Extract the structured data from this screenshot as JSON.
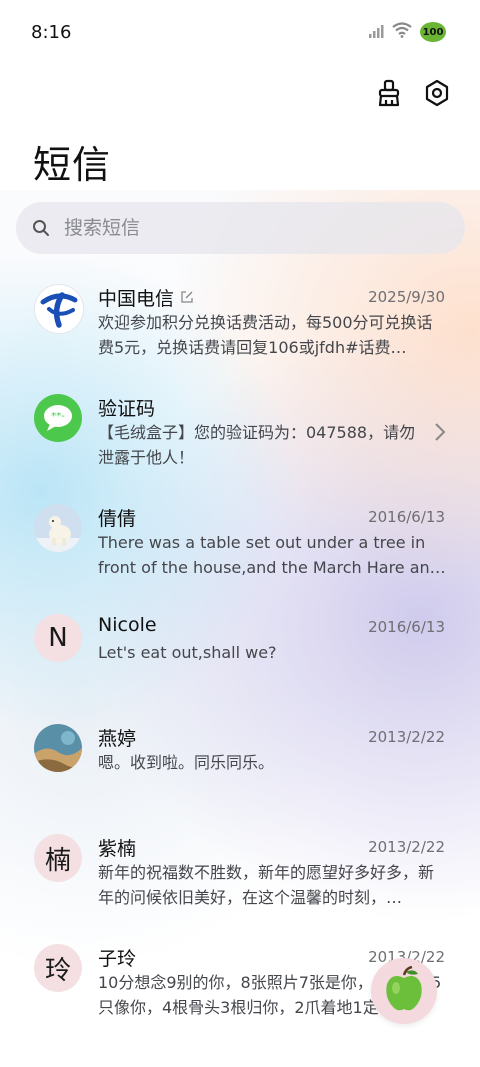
{
  "status_bar": {
    "time": "8:16",
    "battery": "100"
  },
  "header": {
    "title": "短信"
  },
  "search": {
    "placeholder": "搜索短信"
  },
  "conversations": [
    {
      "name": "中国电信",
      "date": "2025/9/30",
      "preview": "欢迎参加积分兑换话费活动，每500分可兑换话费5元，兑换话费请回复106或jfdh#话费…",
      "avatar": "logo"
    },
    {
      "name": "验证码",
      "date": "",
      "preview": "【毛绒盒子】您的验证码为：047588，请勿泄露于他人！",
      "avatar": "message"
    },
    {
      "name": "倩倩",
      "date": "2016/6/13",
      "preview": "There was a table set out under a tree in front of the house,and the March Hare an…",
      "avatar": "photo"
    },
    {
      "name": "Nicole",
      "date": "2016/6/13",
      "preview": "Let's eat out,shall we?",
      "avatar": "letter",
      "letter": "N"
    },
    {
      "name": "燕婷",
      "date": "2013/2/22",
      "preview": "嗯。收到啦。同乐同乐。",
      "avatar": "photo"
    },
    {
      "name": "紫楠",
      "date": "2013/2/22",
      "preview": "新年的祝福数不胜数，新年的愿望好多好多，新年的问候依旧美好，在这个温馨的时刻，…",
      "avatar": "letter",
      "letter": "楠"
    },
    {
      "name": "子玲",
      "date": "2013/2/22",
      "preview": "10分想念9别的你，8张照片7张是你，6只小狗5只像你，4根骨头3根归你，2爪着地1定…",
      "avatar": "letter",
      "letter": "玲"
    }
  ],
  "colors": {
    "accent_green": "#4cc84c",
    "telecom_blue": "#1a4fb5",
    "avatar_pink": "#f4dfe3"
  }
}
